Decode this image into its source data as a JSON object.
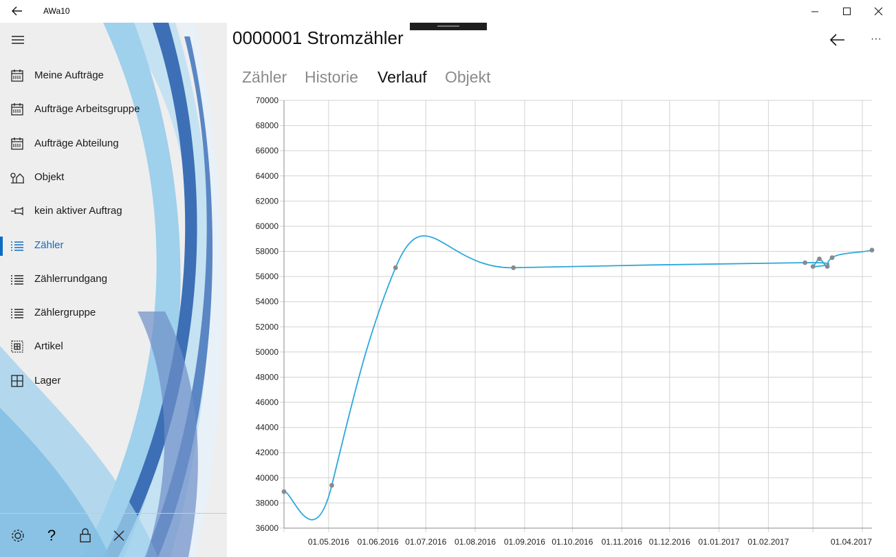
{
  "window": {
    "title": "AWa10"
  },
  "colors": {
    "accent": "#0b6cc4",
    "line": "#2aa7dc",
    "point": "#8a8a8a"
  },
  "sidebar": {
    "items": [
      {
        "label": "Meine Aufträge",
        "icon": "calendar-icon"
      },
      {
        "label": "Aufträge Arbeitsgruppe",
        "icon": "calendar-icon"
      },
      {
        "label": "Aufträge Abteilung",
        "icon": "calendar-icon"
      },
      {
        "label": "Objekt",
        "icon": "home-icon"
      },
      {
        "label": "kein aktiver Auftrag",
        "icon": "pin-icon"
      },
      {
        "label": "Zähler",
        "icon": "list-icon",
        "active": true
      },
      {
        "label": "Zählerrundgang",
        "icon": "list-icon"
      },
      {
        "label": "Zählergruppe",
        "icon": "list-icon"
      },
      {
        "label": "Artikel",
        "icon": "box-icon"
      },
      {
        "label": "Lager",
        "icon": "grid-icon"
      }
    ],
    "footer": [
      "gear-icon",
      "help-icon",
      "lock-icon",
      "close-icon"
    ],
    "footer_help_text": "?"
  },
  "main": {
    "title": "0000001 Stromzähler",
    "more_label": "···",
    "tabs": [
      {
        "label": "Zähler",
        "active": false
      },
      {
        "label": "Historie",
        "active": false
      },
      {
        "label": "Verlauf",
        "active": true
      },
      {
        "label": "Objekt",
        "active": false
      }
    ]
  },
  "chart_data": {
    "type": "line",
    "smooth": true,
    "ylim": [
      36000,
      70000
    ],
    "ytick_step": 2000,
    "xlim": [
      "2016-04-03",
      "2017-04-07"
    ],
    "x_tick_labels": [
      "01.05.2016",
      "01.06.2016",
      "01.07.2016",
      "01.08.2016",
      "01.09.2016",
      "01.10.2016",
      "01.11.2016",
      "01.12.2016",
      "01.01.2017",
      "01.02.2017",
      "01.04.2017"
    ],
    "x_gridlines": [
      "2016-04-03",
      "2016-05-01",
      "2016-06-01",
      "2016-07-01",
      "2016-08-01",
      "2016-09-01",
      "2016-10-01",
      "2016-11-01",
      "2016-12-01",
      "2017-01-01",
      "2017-02-01",
      "2017-03-01",
      "2017-04-01"
    ],
    "grid": true,
    "series": [
      {
        "points": [
          {
            "x": "2016-04-03",
            "y": 38900
          },
          {
            "x": "2016-05-03",
            "y": 39400
          },
          {
            "x": "2016-06-12",
            "y": 56700
          },
          {
            "x": "2016-08-25",
            "y": 56700
          },
          {
            "x": "2017-02-24",
            "y": 57100
          },
          {
            "x": "2017-03-01",
            "y": 56800
          },
          {
            "x": "2017-03-05",
            "y": 57400
          },
          {
            "x": "2017-03-10",
            "y": 56800
          },
          {
            "x": "2017-03-13",
            "y": 57500
          },
          {
            "x": "2017-04-07",
            "y": 58100
          }
        ]
      }
    ]
  }
}
